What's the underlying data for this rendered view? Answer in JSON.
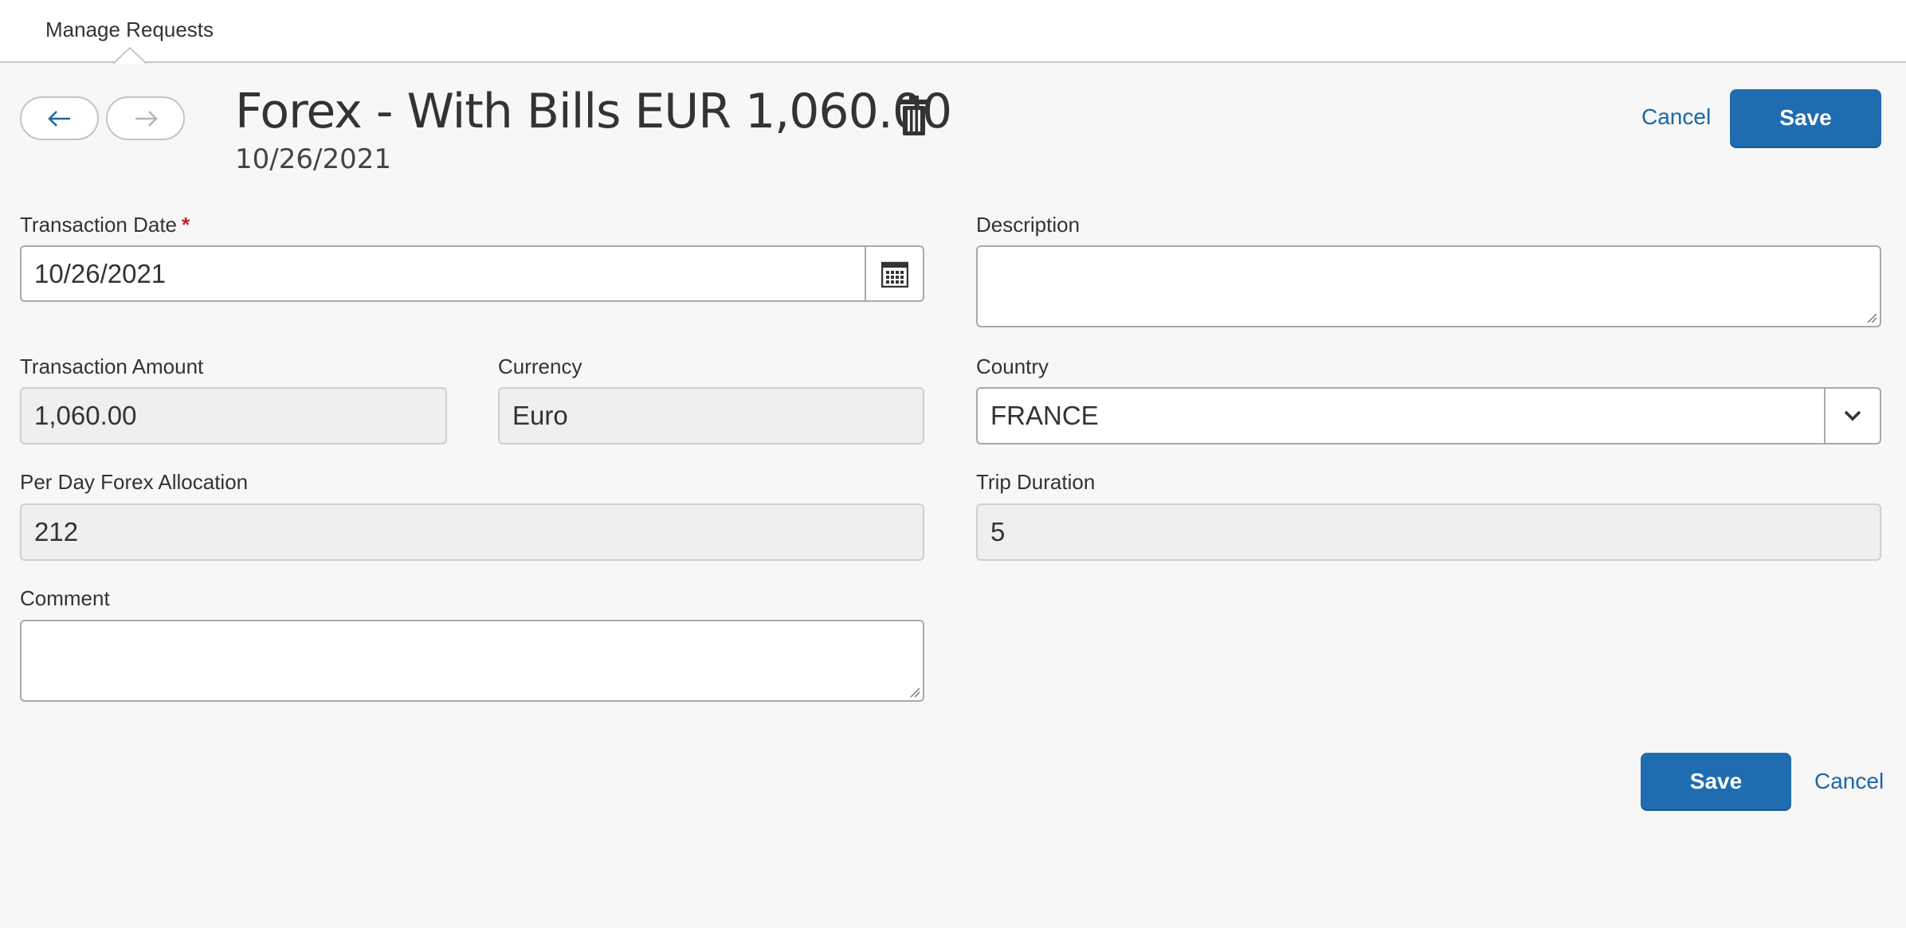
{
  "topnav": {
    "tab_label": "Manage Requests"
  },
  "header": {
    "title": "Forex - With Bills EUR 1,060.00",
    "date": "10/26/2021",
    "cancel_label": "Cancel",
    "save_label": "Save"
  },
  "form": {
    "transaction_date": {
      "label": "Transaction Date",
      "required_mark": "*",
      "value": "10/26/2021"
    },
    "description": {
      "label": "Description",
      "value": ""
    },
    "transaction_amount": {
      "label": "Transaction Amount",
      "value": "1,060.00"
    },
    "currency": {
      "label": "Currency",
      "value": "Euro"
    },
    "country": {
      "label": "Country",
      "value": "FRANCE"
    },
    "per_day_forex": {
      "label": "Per Day Forex Allocation",
      "value": "212"
    },
    "trip_duration": {
      "label": "Trip Duration",
      "value": "5"
    },
    "comment": {
      "label": "Comment",
      "value": ""
    }
  },
  "footer": {
    "save_label": "Save",
    "cancel_label": "Cancel"
  },
  "colors": {
    "accent": "#1f6cb0",
    "link": "#1a67a8",
    "required": "#c0252a"
  },
  "icons": [
    "arrow-left-icon",
    "arrow-right-icon",
    "trash-icon",
    "calendar-icon",
    "chevron-down-icon"
  ]
}
